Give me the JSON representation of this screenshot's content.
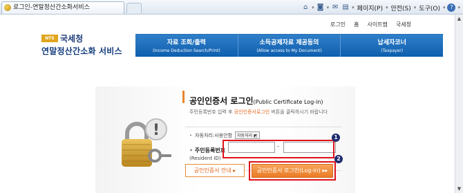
{
  "browser": {
    "tab_title": "로그인-연말정산간소화서비스",
    "toolbar": {
      "page_menu": "페이지(P)",
      "safety_menu": "안전(S)",
      "tools_menu": "도구(O)",
      "help_menu": "?"
    }
  },
  "header": {
    "util_links": [
      "로그인",
      "홈",
      "사이트맵",
      "국세청"
    ],
    "logo_org": "국세청",
    "logo_emblem": "NTS",
    "logo_service": "연말정산간소화 서비스"
  },
  "nav": {
    "items": [
      {
        "label": "자료 조회/출력",
        "sub": "(Income Deduction Search/Print)"
      },
      {
        "label": "소득공제자료 제공동의",
        "sub": "(Allow access to My Document)"
      },
      {
        "label": "납세자코너",
        "sub": "(Taxpayer)"
      }
    ]
  },
  "login": {
    "title": "공인인증서 로그인",
    "title_en": "(Public Certificate Log-in)",
    "desc_pre": "주민등록번호 입력 후 ",
    "desc_hl": "공인인증서로그인",
    "desc_post": " 버튼을 클릭하시기 바랍니다",
    "auto_label": "자동처리:사용안함",
    "auto_button": "자동처리",
    "id_label": "주민등록번호",
    "id_label_en": "(Resident ID)",
    "id_first": "",
    "id_second": "",
    "id_dash": "-",
    "guide_button": "공인인증서 안내 ▸",
    "login_button": "공인인증서 로그인(Log-in) ▸▸"
  },
  "annotations": {
    "badge_1": "1",
    "badge_2": "2",
    "highlight_color": "#e0111a",
    "badge_color": "#1e2b6f"
  },
  "colors": {
    "nav_blue": "#0e5fae",
    "accent_orange": "#ea7a24"
  }
}
